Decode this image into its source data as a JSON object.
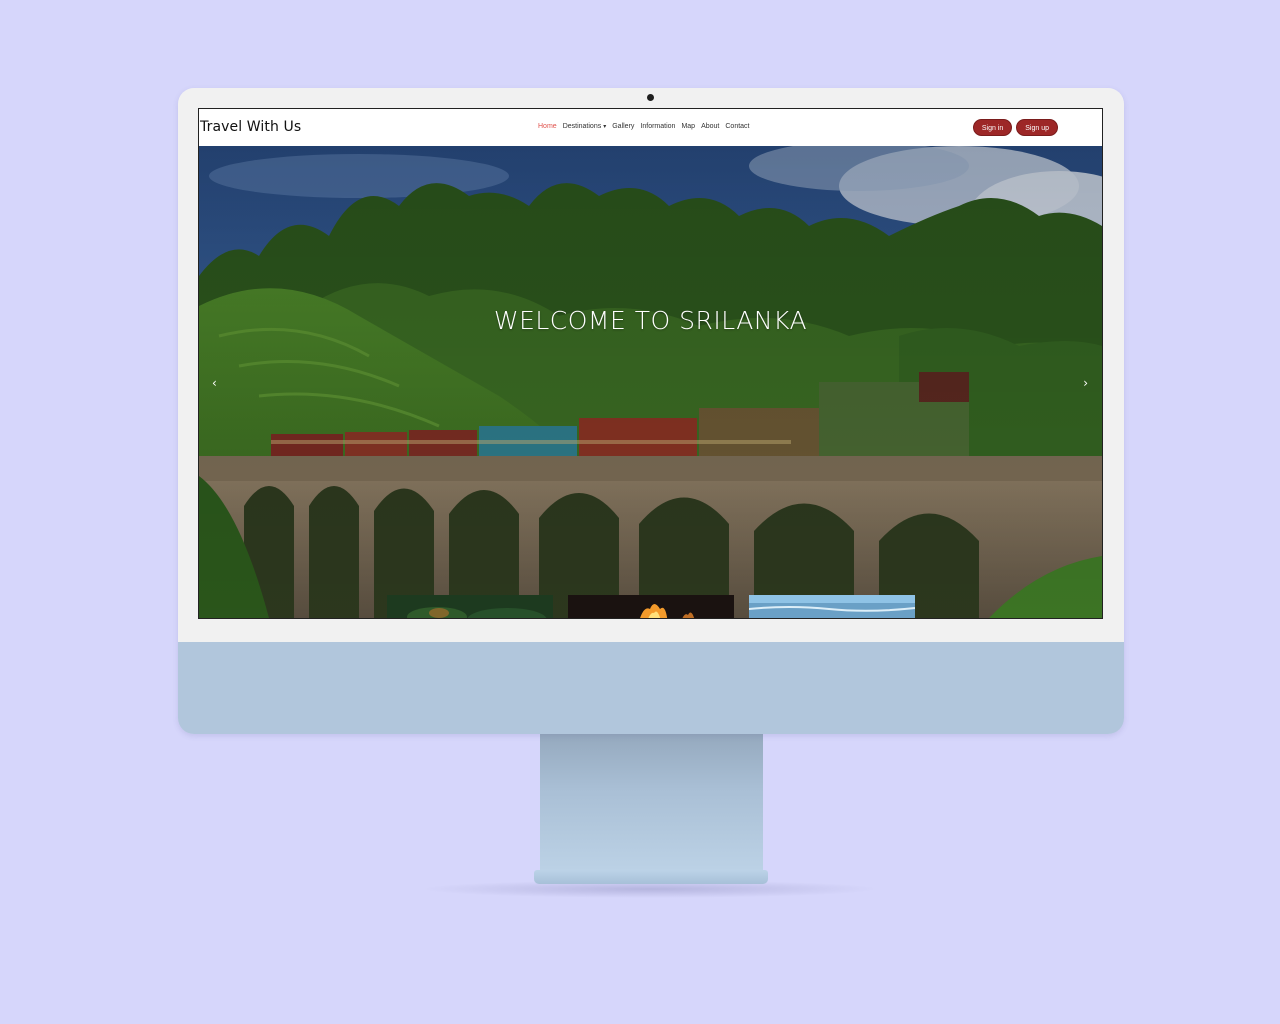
{
  "navbar": {
    "brand": "Travel With Us",
    "links": [
      {
        "label": "Home",
        "active": true
      },
      {
        "label": "Destinations",
        "dropdown": true
      },
      {
        "label": "Gallery"
      },
      {
        "label": "Information"
      },
      {
        "label": "Map"
      },
      {
        "label": "About"
      },
      {
        "label": "Contact"
      }
    ],
    "signin_label": "Sign in",
    "signup_label": "Sign up"
  },
  "hero": {
    "title": "WELCOME TO SRILANKA",
    "prev_icon": "‹",
    "next_icon": "›"
  },
  "colors": {
    "accent": "#9d2727",
    "active_link": "#e0524c",
    "background": "#d6d6fb"
  }
}
